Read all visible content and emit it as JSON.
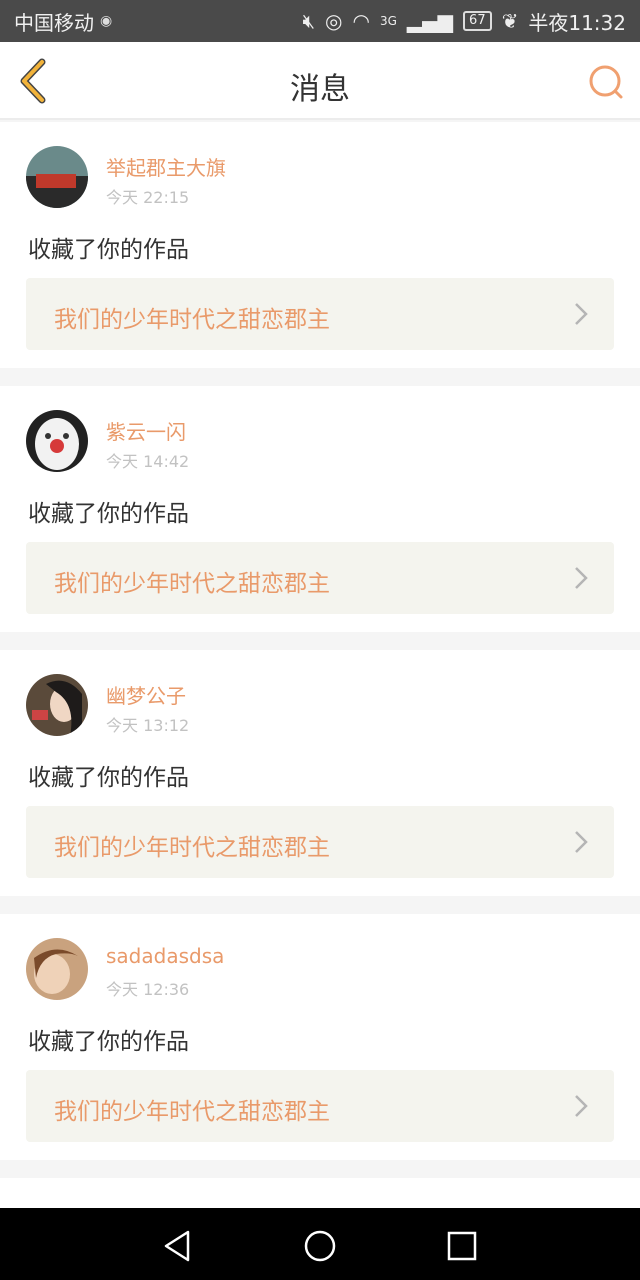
{
  "status_bar": {
    "carrier": "中国移动",
    "net": "3G",
    "battery": "67",
    "time": "半夜11:32"
  },
  "header": {
    "title": "消息",
    "back_icon": "back-chevron-icon",
    "search_icon": "search-icon"
  },
  "messages": [
    {
      "user": "举起郡主大旗",
      "time": "今天 22:15",
      "action": "收藏了你的作品",
      "work": "我们的少年时代之甜恋郡主"
    },
    {
      "user": "紫云一闪",
      "time": "今天 14:42",
      "action": "收藏了你的作品",
      "work": "我们的少年时代之甜恋郡主"
    },
    {
      "user": "幽梦公子",
      "time": "今天 13:12",
      "action": "收藏了你的作品",
      "work": "我们的少年时代之甜恋郡主"
    },
    {
      "user": "sadadasdsa",
      "time": "今天 12:36",
      "action": "收藏了你的作品",
      "work": "我们的少年时代之甜恋郡主"
    }
  ],
  "colors": {
    "accent": "#e99a6a",
    "back_icon": "#f2b33a"
  }
}
